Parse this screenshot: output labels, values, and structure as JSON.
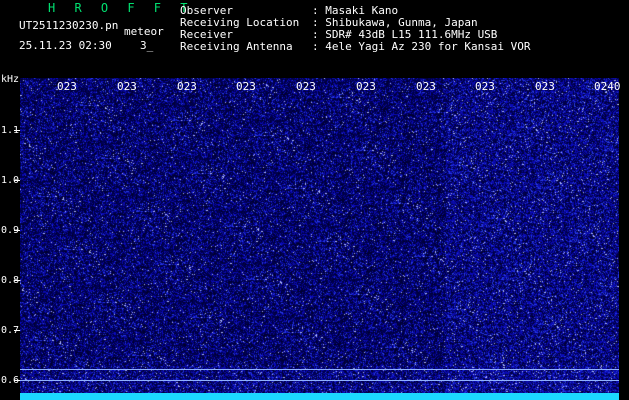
{
  "header": {
    "title": "H R O F F T",
    "filename": "UT2511230230.pn",
    "mode": "meteor",
    "datetime": "25.11.23 02:30",
    "count": "3_",
    "fields": [
      {
        "label": "Observer",
        "value": ": Masaki Kano"
      },
      {
        "label": "Receiving Location",
        "value": ": Shibukawa, Gunma, Japan"
      },
      {
        "label": "Receiver",
        "value": ": SDR# 43dB L15 111.6MHz USB"
      },
      {
        "label": "Receiving Antenna",
        "value": ": 4ele Yagi Az 230 for Kansai VOR"
      }
    ]
  },
  "axis": {
    "y_unit": "kHz",
    "y_ticks": [
      "1.1",
      "1.0",
      "0.9",
      "0.8",
      "0.7",
      "0.6"
    ],
    "x_ticks": [
      "023",
      "023",
      "023",
      "023",
      "023",
      "023",
      "023",
      "023",
      "023",
      "0240"
    ]
  },
  "colors": {
    "background": "#000000",
    "spectrum": "#04049a",
    "title": "#00e070",
    "baseline": "#1cd8ff"
  }
}
